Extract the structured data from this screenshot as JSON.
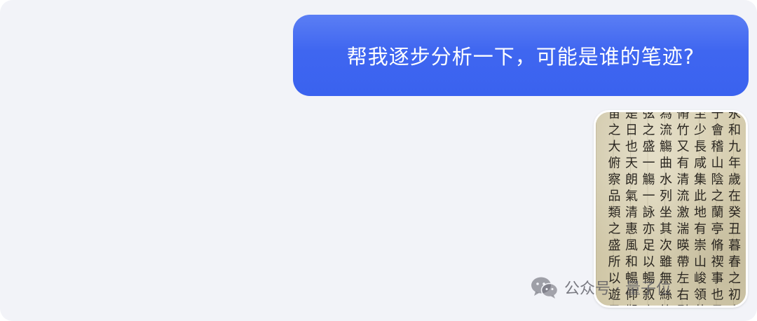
{
  "chat": {
    "user_message": "帮我逐步分析一下，可能是谁的笔迹?",
    "image": {
      "columns": [
        "永和九年歲在癸丑暮春之初會",
        "于會稽山陰之蘭亭脩禊事也羣賢畢",
        "至少長咸集此地有崇山峻領茂林",
        "脩竹又有清流激湍暎帶左右引以",
        "為流觴曲水列坐其次雖無絲竹管",
        "弦之盛一觴一詠亦足以暢叙幽情",
        "是日也天朗氣清惠風和暢仰觀宇",
        "宙之大俯察品類之盛所以遊目"
      ]
    }
  },
  "watermark": {
    "text": "公众号 · 量子位"
  },
  "colors": {
    "bubble": "#3f66f0",
    "background": "#f2f3f8"
  }
}
